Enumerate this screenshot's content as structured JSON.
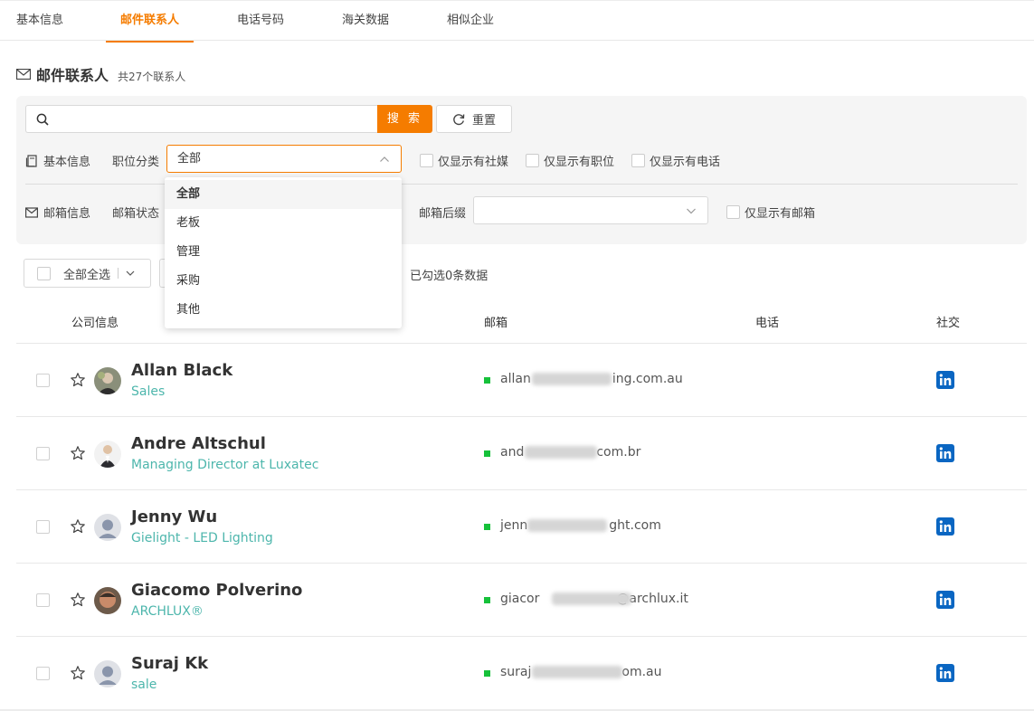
{
  "tabs": [
    {
      "label": "基本信息"
    },
    {
      "label": "邮件联系人"
    },
    {
      "label": "电话号码"
    },
    {
      "label": "海关数据"
    },
    {
      "label": "相似企业"
    }
  ],
  "section": {
    "title": "邮件联系人",
    "count": "共27个联系人"
  },
  "search": {
    "value": "",
    "placeholder": "",
    "button": "搜 索",
    "reset": "重置"
  },
  "filters": {
    "basic_label": "基本信息",
    "position_label": "职位分类",
    "position_value": "全部",
    "only_social": "仅显示有社媒",
    "only_position": "仅显示有职位",
    "only_phone": "仅显示有电话",
    "email_info_label": "邮箱信息",
    "email_status_label": "邮箱状态",
    "email_suffix_label": "邮箱后缀",
    "email_suffix_value": "",
    "only_email": "仅显示有邮箱"
  },
  "dropdown": {
    "options": [
      "全部",
      "老板",
      "管理",
      "采购",
      "其他"
    ],
    "selected": 0
  },
  "bulk": {
    "select_all": "全部全选",
    "selected_count": "已勾选0条数据"
  },
  "table": {
    "headers": {
      "company": "公司信息",
      "email": "邮箱",
      "phone": "电话",
      "social": "社交"
    },
    "rows": [
      {
        "name": "Allan Black",
        "title": "Sales",
        "email_pre": "allan",
        "email_post": "ing.com.au"
      },
      {
        "name": "Andre Altschul",
        "title": "Managing Director at Luxatec",
        "email_pre": "and",
        "email_post": "com.br"
      },
      {
        "name": "Jenny Wu",
        "title": "Gielight - LED Lighting",
        "email_pre": "jenn",
        "email_post": "ght.com"
      },
      {
        "name": "Giacomo Polverino",
        "title": "ARCHLUX®",
        "email_pre": "giacor",
        "email_post": "@archlux.it"
      },
      {
        "name": "Suraj Kk",
        "title": "sale",
        "email_pre": "suraj",
        "email_post": "om.au"
      }
    ]
  },
  "colors": {
    "accent": "#f57c00",
    "title_teal": "#4db6ac",
    "status_green": "#16c13a",
    "linkedin": "#0a66c2"
  }
}
